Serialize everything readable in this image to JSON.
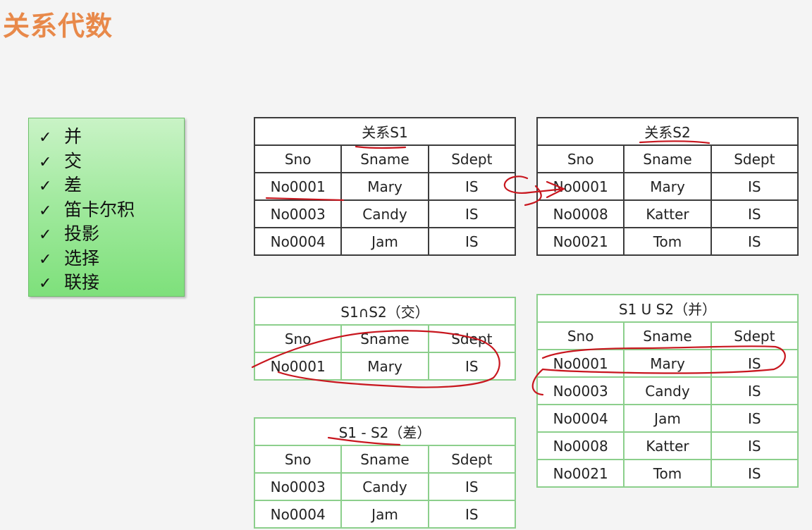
{
  "title": "关系代数",
  "checklist": [
    {
      "check": "✓",
      "label": "并"
    },
    {
      "check": "✓",
      "label": "交"
    },
    {
      "check": "✓",
      "label": "差"
    },
    {
      "check": "✓",
      "label": "笛卡尔积"
    },
    {
      "check": "✓",
      "label": "投影"
    },
    {
      "check": "✓",
      "label": "选择"
    },
    {
      "check": "✓",
      "label": "联接"
    }
  ],
  "tables": {
    "s1": {
      "caption": "关系S1",
      "headers": [
        "Sno",
        "Sname",
        "Sdept"
      ],
      "rows": [
        [
          "No0001",
          "Mary",
          "IS"
        ],
        [
          "No0003",
          "Candy",
          "IS"
        ],
        [
          "No0004",
          "Jam",
          "IS"
        ]
      ]
    },
    "s2": {
      "caption": "关系S2",
      "headers": [
        "Sno",
        "Sname",
        "Sdept"
      ],
      "rows": [
        [
          "No0001",
          "Mary",
          "IS"
        ],
        [
          "No0008",
          "Katter",
          "IS"
        ],
        [
          "No0021",
          "Tom",
          "IS"
        ]
      ]
    },
    "intersect": {
      "caption": "S1∩S2（交）",
      "headers": [
        "Sno",
        "Sname",
        "Sdept"
      ],
      "rows": [
        [
          "No0001",
          "Mary",
          "IS"
        ]
      ]
    },
    "union": {
      "caption": "S1 U S2（并）",
      "headers": [
        "Sno",
        "Sname",
        "Sdept"
      ],
      "rows": [
        [
          "No0001",
          "Mary",
          "IS"
        ],
        [
          "No0003",
          "Candy",
          "IS"
        ],
        [
          "No0004",
          "Jam",
          "IS"
        ],
        [
          "No0008",
          "Katter",
          "IS"
        ],
        [
          "No0021",
          "Tom",
          "IS"
        ]
      ]
    },
    "difference": {
      "caption": "S1 - S2（差）",
      "headers": [
        "Sno",
        "Sname",
        "Sdept"
      ],
      "rows": [
        [
          "No0003",
          "Candy",
          "IS"
        ],
        [
          "No0004",
          "Jam",
          "IS"
        ]
      ]
    }
  },
  "ink_color": "#c8161e"
}
